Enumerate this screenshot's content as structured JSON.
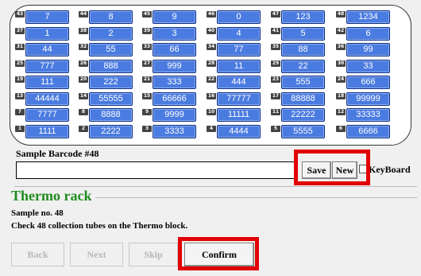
{
  "rack": {
    "rows": [
      [
        {
          "idx": "43",
          "value": "7"
        },
        {
          "idx": "44",
          "value": "8"
        },
        {
          "idx": "45",
          "value": "9"
        },
        {
          "idx": "46",
          "value": "0"
        },
        {
          "idx": "47",
          "value": "123"
        },
        {
          "idx": "48",
          "value": "1234"
        }
      ],
      [
        {
          "idx": "37",
          "value": "1"
        },
        {
          "idx": "38",
          "value": "2"
        },
        {
          "idx": "39",
          "value": "3"
        },
        {
          "idx": "40",
          "value": "4"
        },
        {
          "idx": "41",
          "value": "5"
        },
        {
          "idx": "42",
          "value": "6"
        }
      ],
      [
        {
          "idx": "31",
          "value": "44"
        },
        {
          "idx": "32",
          "value": "55"
        },
        {
          "idx": "33",
          "value": "66"
        },
        {
          "idx": "34",
          "value": "77"
        },
        {
          "idx": "35",
          "value": "88"
        },
        {
          "idx": "36",
          "value": "99"
        }
      ],
      [
        {
          "idx": "25",
          "value": "777"
        },
        {
          "idx": "26",
          "value": "888"
        },
        {
          "idx": "27",
          "value": "999"
        },
        {
          "idx": "28",
          "value": "11"
        },
        {
          "idx": "29",
          "value": "22"
        },
        {
          "idx": "30",
          "value": "33"
        }
      ],
      [
        {
          "idx": "19",
          "value": "111"
        },
        {
          "idx": "20",
          "value": "222"
        },
        {
          "idx": "21",
          "value": "333"
        },
        {
          "idx": "22",
          "value": "444"
        },
        {
          "idx": "23",
          "value": "555"
        },
        {
          "idx": "24",
          "value": "666"
        }
      ],
      [
        {
          "idx": "13",
          "value": "44444"
        },
        {
          "idx": "14",
          "value": "55555"
        },
        {
          "idx": "15",
          "value": "66666"
        },
        {
          "idx": "16",
          "value": "77777"
        },
        {
          "idx": "17",
          "value": "88888"
        },
        {
          "idx": "18",
          "value": "99999"
        }
      ],
      [
        {
          "idx": "7",
          "value": "7777"
        },
        {
          "idx": "8",
          "value": "8888"
        },
        {
          "idx": "9",
          "value": "9999"
        },
        {
          "idx": "10",
          "value": "11111"
        },
        {
          "idx": "11",
          "value": "22222"
        },
        {
          "idx": "12",
          "value": "33333"
        }
      ],
      [
        {
          "idx": "1",
          "value": "1111"
        },
        {
          "idx": "2",
          "value": "2222"
        },
        {
          "idx": "3",
          "value": "3333"
        },
        {
          "idx": "4",
          "value": "4444"
        },
        {
          "idx": "5",
          "value": "5555"
        },
        {
          "idx": "6",
          "value": "6666"
        }
      ]
    ]
  },
  "barcode": {
    "label": "Sample Barcode #48",
    "value": ""
  },
  "buttons": {
    "save": "Save",
    "new": "New",
    "keyboard": "KeyBoard",
    "back": "Back",
    "next": "Next",
    "skip": "Skip",
    "confirm": "Confirm"
  },
  "section": {
    "title": "Thermo rack",
    "sample_no": "Sample no. 48",
    "instruction": "Check 48 collection tubes on the Thermo block."
  },
  "colors": {
    "tube": "#4a7be0",
    "highlight": "#e20000",
    "title": "#1f8c1f"
  }
}
